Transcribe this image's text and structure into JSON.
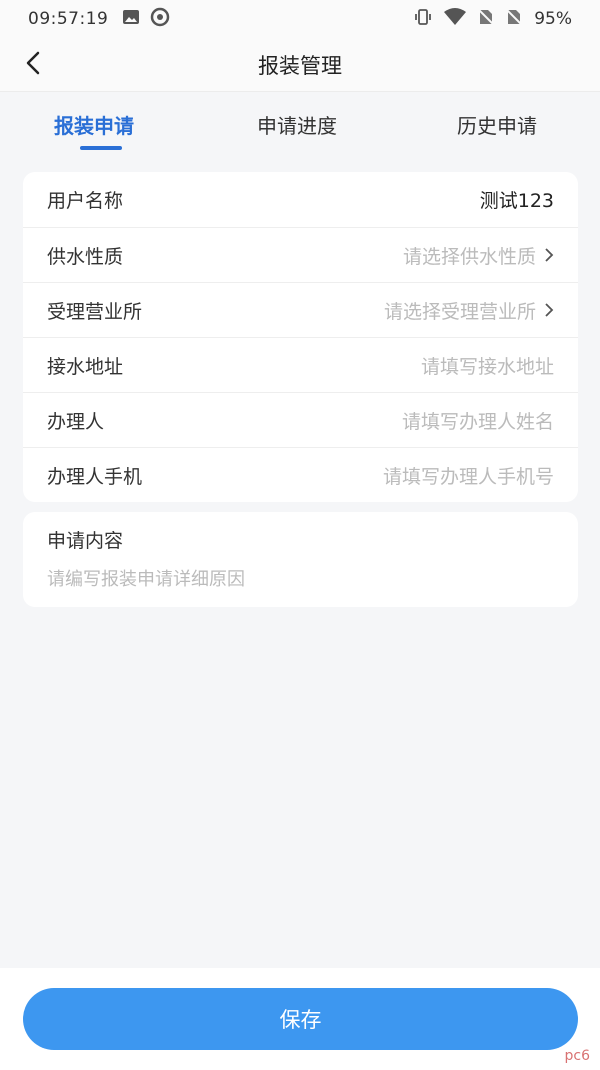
{
  "statusbar": {
    "time": "09:57:19",
    "battery": "95%"
  },
  "navbar": {
    "title": "报装管理"
  },
  "tabs": [
    {
      "label": "报装申请",
      "active": true
    },
    {
      "label": "申请进度",
      "active": false
    },
    {
      "label": "历史申请",
      "active": false
    }
  ],
  "form": {
    "rows": [
      {
        "label": "用户名称",
        "value": "测试123"
      },
      {
        "label": "供水性质",
        "placeholder": "请选择供水性质"
      },
      {
        "label": "受理营业所",
        "placeholder": "请选择受理营业所"
      },
      {
        "label": "接水地址",
        "placeholder": "请填写接水地址"
      },
      {
        "label": "办理人",
        "placeholder": "请填写办理人姓名"
      },
      {
        "label": "办理人手机",
        "placeholder": "请填写办理人手机号"
      }
    ]
  },
  "content": {
    "label": "申请内容",
    "placeholder": "请编写报装申请详细原因"
  },
  "save_label": "保存",
  "watermark": "pc6",
  "colors": {
    "accent": "#2a6fd6",
    "button": "#3d97f0",
    "background": "#f5f6f8"
  }
}
